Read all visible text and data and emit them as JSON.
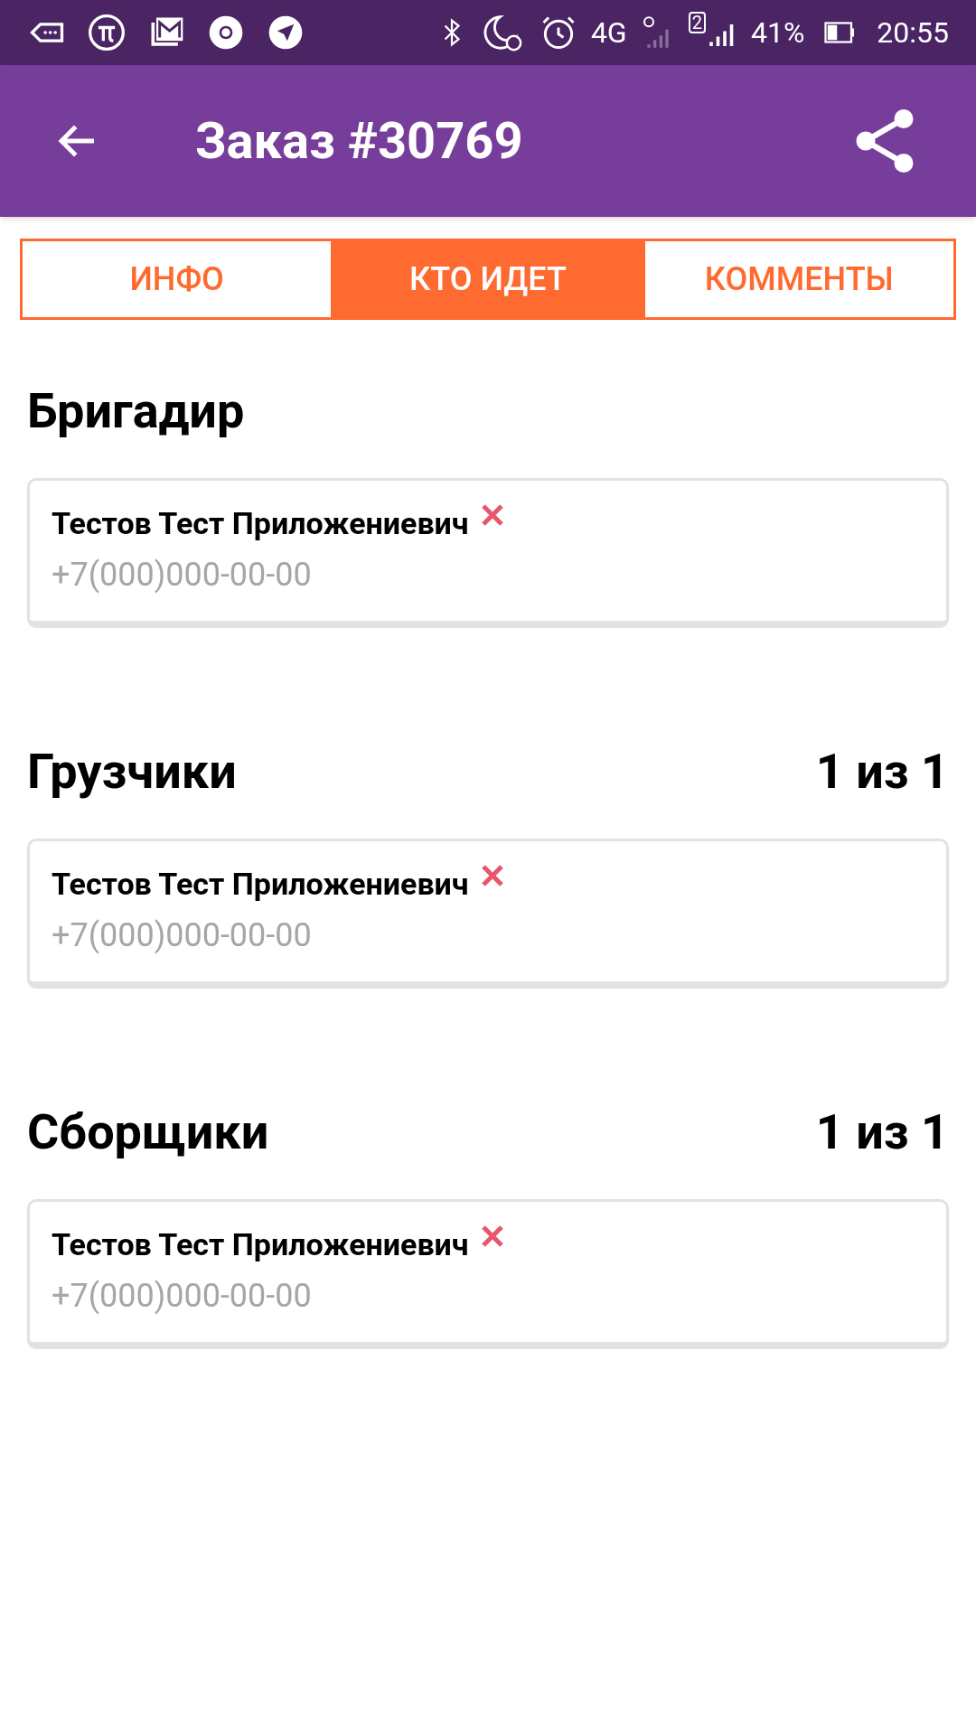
{
  "status_bar": {
    "network": "4G",
    "sim": "2",
    "battery": "41%",
    "time": "20:55"
  },
  "app_bar": {
    "title": "Заказ #30769"
  },
  "tabs": [
    {
      "label": "ИНФО",
      "selected": false
    },
    {
      "label": "КТО ИДЕТ",
      "selected": true
    },
    {
      "label": "КОММЕНТЫ",
      "selected": false
    }
  ],
  "sections": [
    {
      "title": "Бригадир",
      "people": [
        {
          "name": "Тестов Тест Приложениевич",
          "phone": "+7(000)000-00-00"
        }
      ]
    },
    {
      "title": "Грузчики",
      "count": "1 из 1",
      "people": [
        {
          "name": "Тестов Тест Приложениевич",
          "phone": "+7(000)000-00-00"
        }
      ]
    },
    {
      "title": "Сборщики",
      "count": "1 из 1",
      "people": [
        {
          "name": "Тестов Тест Приложениевич",
          "phone": "+7(000)000-00-00"
        }
      ]
    }
  ]
}
